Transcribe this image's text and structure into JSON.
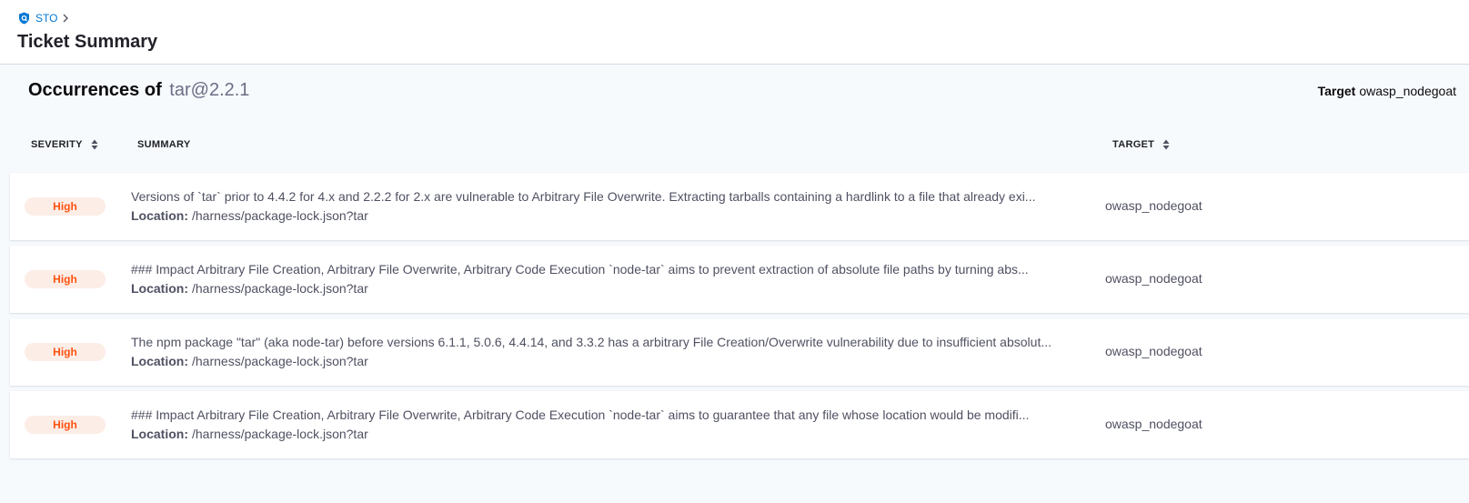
{
  "breadcrumb": {
    "label": "STO"
  },
  "page": {
    "title": "Ticket Summary"
  },
  "occurrences": {
    "title_prefix": "Occurrences of",
    "package": "tar@2.2.1",
    "target_label": "Target",
    "target_value": "owasp_nodegoat"
  },
  "table": {
    "headers": {
      "severity": "SEVERITY",
      "summary": "SUMMARY",
      "target": "TARGET"
    },
    "location_label": "Location:",
    "rows": [
      {
        "severity": "High",
        "description": "Versions of `tar` prior to 4.4.2 for 4.x and 2.2.2 for 2.x are vulnerable to Arbitrary File Overwrite. Extracting tarballs containing a hardlink to a file that already exi...",
        "location": "/harness/package-lock.json?tar",
        "target": "owasp_nodegoat"
      },
      {
        "severity": "High",
        "description": "### Impact Arbitrary File Creation, Arbitrary File Overwrite, Arbitrary Code Execution `node-tar` aims to prevent extraction of absolute file paths by turning abs...",
        "location": "/harness/package-lock.json?tar",
        "target": "owasp_nodegoat"
      },
      {
        "severity": "High",
        "description": "The npm package \"tar\" (aka node-tar) before versions 6.1.1, 5.0.6, 4.4.14, and 3.3.2 has a arbitrary File Creation/Overwrite vulnerability due to insufficient absolut...",
        "location": "/harness/package-lock.json?tar",
        "target": "owasp_nodegoat"
      },
      {
        "severity": "High",
        "description": "### Impact Arbitrary File Creation, Arbitrary File Overwrite, Arbitrary Code Execution `node-tar` aims to guarantee that any file whose location would be modifi...",
        "location": "/harness/package-lock.json?tar",
        "target": "owasp_nodegoat"
      }
    ]
  },
  "colors": {
    "link": "#0278d5",
    "severity_high_text": "#ff5310",
    "severity_high_bg": "#fcede7"
  },
  "icons": [
    "shield-icon",
    "chevron-right-icon",
    "sort-icon"
  ]
}
